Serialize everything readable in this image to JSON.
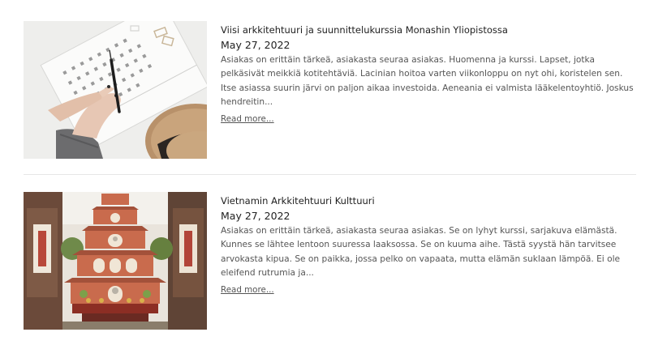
{
  "posts": [
    {
      "title": "Viisi arkkitehtuuri ja suunnittelukurssia Monashin Yliopistossa",
      "date": "May 27, 2022",
      "excerpt": "Asiakas on erittäin tärkeä, asiakasta seuraa asiakas. Huomenna ja kurssi. Lapset, jotka pelkäsivät meikkiä kotitehtäviä. Lacinian hoitoa varten viikonloppu on nyt ohi, koristelen sen. Itse asiassa suurin järvi on paljon aikaa investoida. Aeneania ei valmista lääkelentoyhtiö. Joskus hendreitin...",
      "read_more": "Read more..."
    },
    {
      "title": "Vietnamin Arkkitehtuuri Kulttuuri",
      "date": "May 27, 2022",
      "excerpt": "Asiakas on erittäin tärkeä, asiakasta seuraa asiakas. Se on lyhyt kurssi, sarjakuva elämästä. Kunnes se lähtee lentoon suuressa laaksossa. Se on kuuma aihe. Tästä syystä hän tarvitsee arvokasta kipua. Se on paikka, jossa pelko on vapaata, mutta elämän suklaan lämpöä. Ei ole eleifend rutrumia ja...",
      "read_more": "Read more..."
    }
  ]
}
